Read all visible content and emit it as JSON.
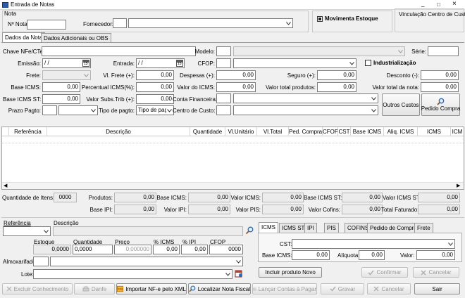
{
  "window": {
    "title": "Entrada de Notas",
    "controls": [
      "_",
      "□",
      "×"
    ]
  },
  "nota": {
    "group": "Nota",
    "numero_label": "Nº Nota:",
    "numero_value": "",
    "fornecedor_label": "Fornecedor:",
    "fornecedor_code": "",
    "fornecedor_name": "",
    "movimenta_estoque_label": "Movimenta Estoque",
    "movimenta_estoque_checked": true,
    "vinculacao_label": "Vinculação Centro de Custo"
  },
  "tabs": [
    {
      "label": "Dados da Nota",
      "active": true
    },
    {
      "label": "Dados Adicionais ou OBS",
      "active": false
    }
  ],
  "fields": {
    "chave_label": "Chave NFe/CTe:",
    "chave_value": "",
    "modelo_label": "Modelo:",
    "modelo_code": "",
    "modelo_value": "",
    "serie_label": "Série:",
    "serie_value": "",
    "emissao_label": "Emissão:",
    "emissao_value": " /  /",
    "entrada_label": "Entrada:",
    "entrada_value": " /  /",
    "cfop_label": "CFOP:",
    "cfop_code": "",
    "cfop_value": "",
    "industrializacao_label": "Industrialização",
    "frete_label": "Frete:",
    "frete_value": "",
    "vl_frete_label": "Vl. Frete (+):",
    "vl_frete_value": "0,00",
    "despesas_label": "Despesas (+):",
    "despesas_value": "0,00",
    "seguro_label": "Seguro (+):",
    "seguro_value": "0,00",
    "desconto_label": "Desconto (-):",
    "desconto_value": "0,00",
    "base_icms_label": "Base ICMS:",
    "base_icms_value": "0,00",
    "perc_icms_label": "Percentual ICMS(%):",
    "perc_icms_value": "0,00",
    "valor_icms_label": "Valor do ICMS:",
    "valor_icms_value": "0,00",
    "valor_total_prod_label": "Valor total produtos:",
    "valor_total_prod_value": "0,00",
    "valor_total_nota_label": "Valor total da nota:",
    "valor_total_nota_value": "0,00",
    "base_icms_st_label": "Base ICMS ST:",
    "base_icms_st_value": "0,00",
    "valor_subs_label": "Valor Subs.Trib (+):",
    "valor_subs_value": "0,00",
    "conta_financeira_label": "Conta Financeira:",
    "prazo_label": "Prazo Pagto:",
    "tipo_pagto_label": "Tipo de pagto:",
    "tipo_pagto_value": "Tipo de pagame",
    "centro_custo_label": "Centro de Custo:",
    "outros_custos_label": "Outros Custos",
    "pedido_compra_label": "Pedido Compra"
  },
  "table": {
    "columns": [
      "",
      "Referência",
      "Descrição",
      "Quantidade",
      "Vl.Unitário",
      "Vl.Total",
      "Ped. Compra",
      "CFOP",
      "CST",
      "Base ICMS",
      "Aliq. ICMS",
      "ICMS",
      "ICM"
    ]
  },
  "totals": {
    "qtd_itens_label": "Quantidade de Itens:",
    "qtd_itens_value": "0000",
    "produtos_label": "Produtos:",
    "produtos_value": "0,00",
    "base_icms_label": "Base ICMS:",
    "base_icms_value": "0,00",
    "valor_icms_label": "Valor ICMS:",
    "valor_icms_value": "0,00",
    "base_icms_st_label": "Base ICMS ST:",
    "base_icms_st_value": "0,00",
    "valor_icms_st_label": "Valor ICMS ST:",
    "valor_icms_st_value": "0,00",
    "base_ipi_label": "Base IPI:",
    "base_ipi_value": "0,00",
    "valor_ipi_label": "Valor IPI:",
    "valor_ipi_value": "0,00",
    "valor_pis_label": "Valor PIS:",
    "valor_pis_value": "0,00",
    "valor_cofins_label": "Valor Cofins:",
    "valor_cofins_value": "0,00",
    "total_faturado_label": "Total Faturado:",
    "total_faturado_value": "0,00"
  },
  "item": {
    "referencia_label": "Referência",
    "descricao_label": "Descrição",
    "estoque_label": "Estoque",
    "estoque_value": "0,0000",
    "quantidade_label": "Quantidade",
    "quantidade_value": "0,0000",
    "preco_label": "Preço",
    "preco_value": "0,000000",
    "perc_icms_label": "% ICMS",
    "perc_icms_value": "0,00",
    "perc_ipi_label": "% IPI",
    "perc_ipi_value": "0,00",
    "cfop_label": "CFOP",
    "cfop_value": "0000",
    "almoxarifado_label": "Almoxarifado:",
    "lote_label": "Lote:"
  },
  "tax_tabs": [
    "ICMS",
    "ICMS ST",
    "IPI",
    "PIS",
    "COFINS",
    "Pedido de Compra",
    "Frete"
  ],
  "tax": {
    "cst_label": "CST:",
    "base_icms_label": "Base ICMS:",
    "base_icms_value": "0,00",
    "aliquota_label": "Alíquota:",
    "aliquota_value": "0,00",
    "valor_label": "Valor:",
    "valor_value": "0,00"
  },
  "item_buttons": {
    "incluir": "Incluir produto Novo",
    "confirmar": "Confirmar",
    "cancelar": "Cancelar"
  },
  "bottom": {
    "excluir": "Excluir Conhecimento",
    "danfe": "Danfe",
    "importar": "Importar NF-e pelo XML",
    "localizar": "Localizar Nota Fiscal",
    "lancar": "Lançar Contas à Pagar",
    "gravar": "Gravar",
    "cancelar": "Cancelar",
    "sair": "Sair"
  },
  "colors": {
    "accent": "#1e3f8a",
    "disabled": "#9a9a9a"
  }
}
